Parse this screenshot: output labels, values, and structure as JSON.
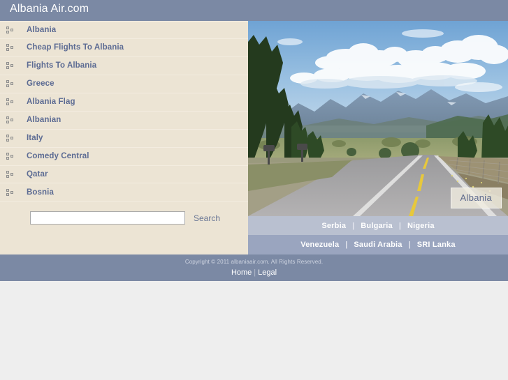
{
  "header": {
    "site_title": "Albania Air.com",
    "background_color": "#7b89a4"
  },
  "sidebar": {
    "background_color": "#ece4d4",
    "link_color": "#5c6b93",
    "bullet_icon": "sitemap-bullet-icon",
    "items": [
      {
        "label": "Albania"
      },
      {
        "label": "Cheap Flights To Albania"
      },
      {
        "label": "Flights To Albania"
      },
      {
        "label": "Greece"
      },
      {
        "label": "Albania Flag"
      },
      {
        "label": "Albanian"
      },
      {
        "label": "Italy"
      },
      {
        "label": "Comedy Central"
      },
      {
        "label": "Qatar"
      },
      {
        "label": "Bosnia"
      }
    ]
  },
  "search": {
    "value": "",
    "placeholder": "",
    "button_label": "Search"
  },
  "hero": {
    "image_description": "Rural two-lane highway with yellow center line running toward distant mountains under a blue sky with cumulus clouds; pine trees and mailboxes at left, wire fence at right",
    "badge_label": "Albania"
  },
  "related": {
    "row_one": {
      "background_color": "#b9c0d0",
      "separator": "|",
      "links": [
        "Serbia",
        "Bulgaria",
        "Nigeria"
      ]
    },
    "row_two": {
      "background_color": "#9aa5bf",
      "separator": "|",
      "links": [
        "Venezuela",
        "Saudi Arabia",
        "SRI Lanka"
      ]
    }
  },
  "footer": {
    "background_color": "#7b89a4",
    "copyright": "Copyright © 2011 albaniaair.com. All Rights Reserved.",
    "nav_links": [
      "Home",
      "Legal"
    ],
    "nav_separator": "|"
  }
}
